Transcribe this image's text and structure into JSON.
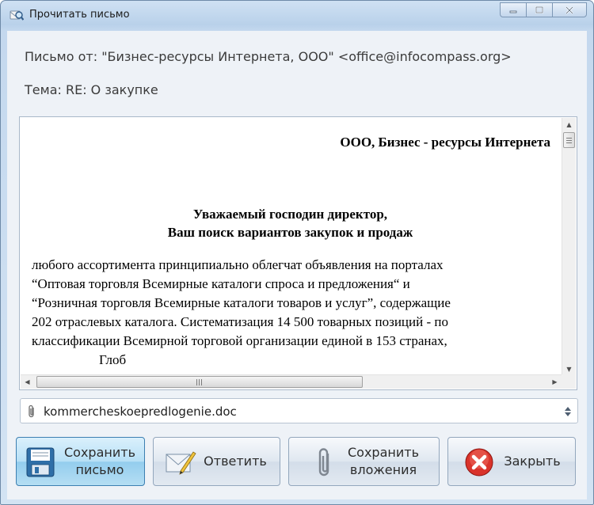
{
  "window": {
    "title": "Прочитать письмо",
    "icons": {
      "app": "magnifier-mail-icon",
      "minimize": "minimize-icon",
      "maximize": "maximize-icon",
      "close": "close-icon"
    }
  },
  "header": {
    "from_line": "Письмо от: \"Бизнес-ресурсы Интернета, ООО\" <office@infocompass.org>",
    "subject_line": "Тема: RE: О закупке"
  },
  "message": {
    "company": "ООО, Бизнес - ресурсы Интернета",
    "greeting_1": "Уважаемый господин директор,",
    "greeting_2": "Ваш поиск вариантов закупок и продаж",
    "lines": [
      "любого ассортимента принципиально облегчат объявления на порталах",
      "“Оптовая торговля Всемирные каталоги спроса и предложения“ и",
      "“Розничная торговля Всемирные каталоги товаров и услуг”, содержащие",
      "202 отраслевых каталога. Систематизация 14 500 товарных позиций - по",
      "классификации Всемирной торговой организации единой в 153 странах,",
      "                    Глоб"
    ]
  },
  "attachment": {
    "filename": "kommercheskoepredlogenie.doc",
    "icon": "paperclip-icon",
    "spinner_icon": "up-down-spinner-icon"
  },
  "buttons": {
    "save_letter": {
      "label_1": "Сохранить",
      "label_2": "письмо",
      "icon": "save-document-icon"
    },
    "reply": {
      "label": "Ответить",
      "icon": "envelope-pen-icon"
    },
    "save_attachments": {
      "label_1": "Сохранить",
      "label_2": "вложения",
      "icon": "paperclip-icon"
    },
    "close": {
      "label": "Закрыть",
      "icon": "red-x-icon"
    }
  },
  "colors": {
    "accent_active": "#93cdee",
    "close_red": "#d9332b"
  }
}
